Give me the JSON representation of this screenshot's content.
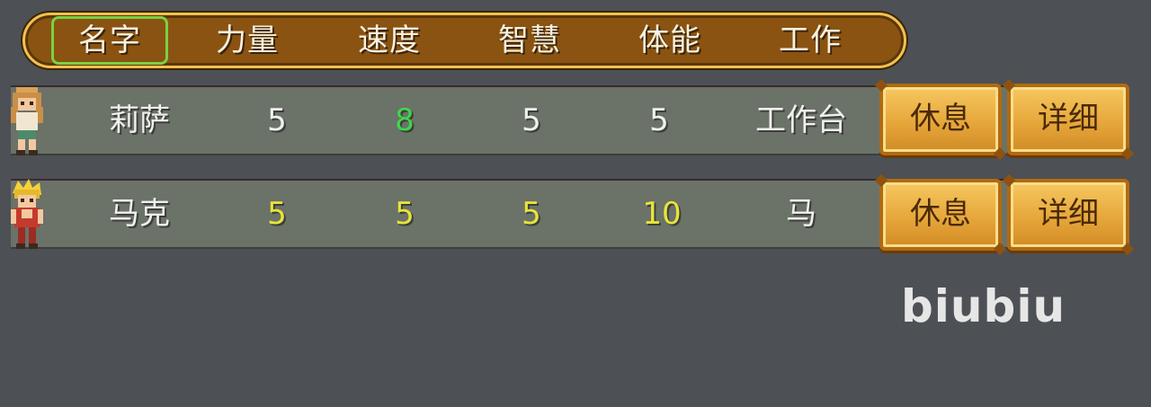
{
  "header": {
    "columns": [
      "名字",
      "力量",
      "速度",
      "智慧",
      "体能",
      "工作"
    ],
    "selected_index": 0,
    "colors": {
      "bar": "#8a5312",
      "border": "#f0c14f",
      "selection": "#7bd043"
    }
  },
  "workers": [
    {
      "name": "莉萨",
      "strength": "5",
      "speed": "8",
      "wisdom": "5",
      "stamina": "5",
      "job": "工作台",
      "avatar": "blonde-girl-sprite",
      "colors": {
        "strength": "#f0f0f0",
        "speed": "#3fd64a",
        "wisdom": "#f0f0f0",
        "stamina": "#f0f0f0",
        "job": "#f0f0f0"
      },
      "rest_label": "休息",
      "detail_label": "详细"
    },
    {
      "name": "马克",
      "strength": "5",
      "speed": "5",
      "wisdom": "5",
      "stamina": "10",
      "job": "马",
      "avatar": "yellow-hair-boy-sprite",
      "colors": {
        "strength": "#e8e43a",
        "speed": "#e8e43a",
        "wisdom": "#e8e43a",
        "stamina": "#e8e43a",
        "job": "#f0f0f0"
      },
      "rest_label": "休息",
      "detail_label": "详细"
    }
  ],
  "watermark": "biubiu"
}
